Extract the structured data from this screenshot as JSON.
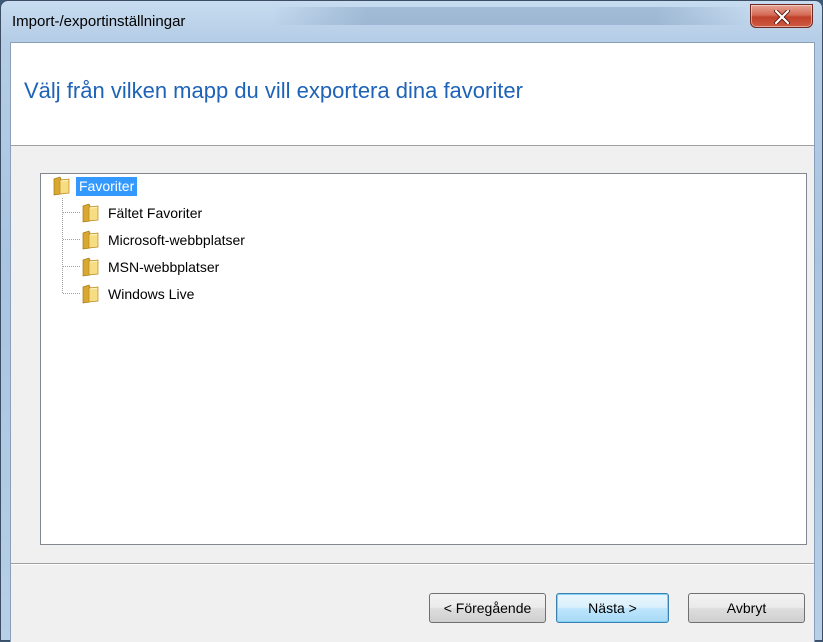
{
  "window": {
    "title": "Import-/exportinställningar"
  },
  "header": {
    "heading": "Välj från vilken mapp du vill exportera dina favoriter"
  },
  "tree": {
    "root": {
      "label": "Favoriter",
      "icon": "folder-icon",
      "selected": true
    },
    "children": [
      {
        "label": "Fältet Favoriter",
        "icon": "folder-icon"
      },
      {
        "label": "Microsoft-webbplatser",
        "icon": "folder-icon"
      },
      {
        "label": "MSN-webbplatser",
        "icon": "folder-icon"
      },
      {
        "label": "Windows Live",
        "icon": "folder-icon"
      }
    ]
  },
  "buttons": {
    "back": "< Föregående",
    "next": "Nästa >",
    "cancel": "Avbryt"
  },
  "colors": {
    "heading": "#1e63b7",
    "selection": "#3399ff",
    "close_button": "#c0412a"
  }
}
